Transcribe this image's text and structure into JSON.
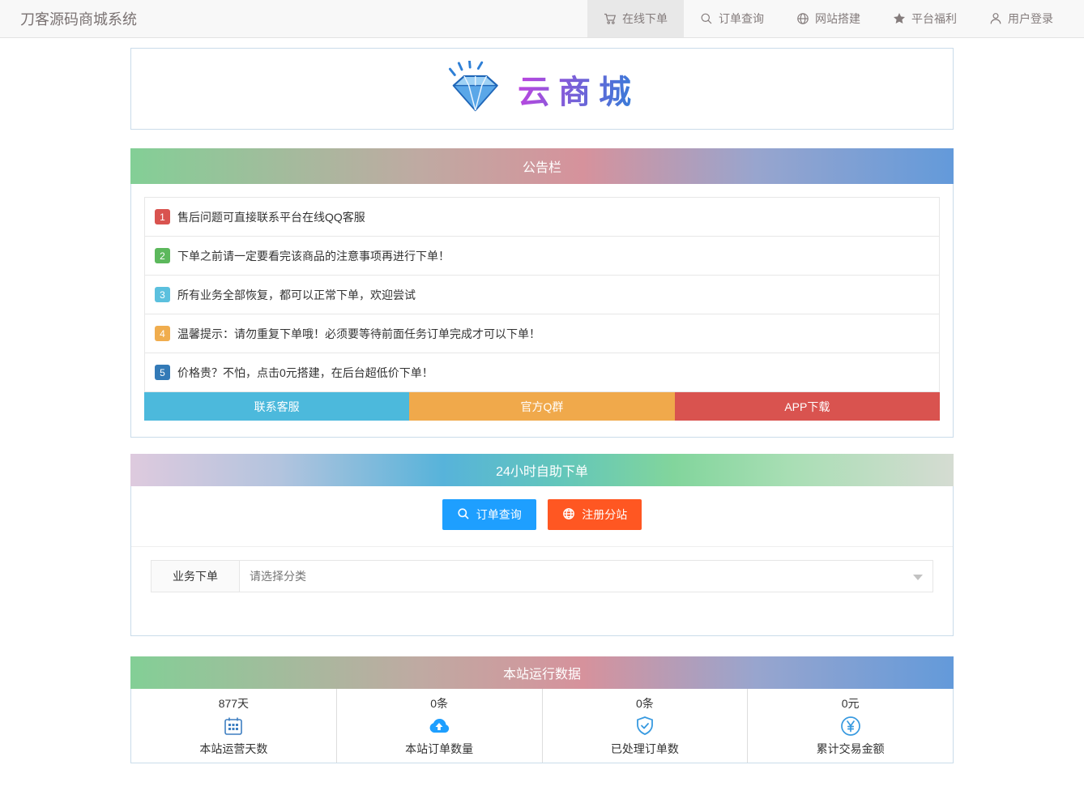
{
  "navbar": {
    "brand": "刀客源码商城系统",
    "items": [
      {
        "label": "在线下单",
        "icon": "cart-icon",
        "active": true
      },
      {
        "label": "订单查询",
        "icon": "search-icon",
        "active": false
      },
      {
        "label": "网站搭建",
        "icon": "globe-icon",
        "active": false
      },
      {
        "label": "平台福利",
        "icon": "star-icon",
        "active": false
      },
      {
        "label": "用户登录",
        "icon": "user-icon",
        "active": false
      }
    ]
  },
  "logo": {
    "text": "云商城",
    "icon": "diamond-logo-icon"
  },
  "announcement": {
    "title": "公告栏",
    "items": [
      {
        "num": "1",
        "text": "售后问题可直接联系平台在线QQ客服",
        "color": "#d9534f"
      },
      {
        "num": "2",
        "text": "下单之前请一定要看完该商品的注意事项再进行下单！",
        "color": "#5cb85c"
      },
      {
        "num": "3",
        "text": "所有业务全部恢复，都可以正常下单，欢迎尝试",
        "color": "#5bc0de"
      },
      {
        "num": "4",
        "text": "温馨提示：请勿重复下单哦！必须要等待前面任务订单完成才可以下单！",
        "color": "#f0ad4e"
      },
      {
        "num": "5",
        "text": "价格贵？不怕，点击0元搭建，在后台超低价下单！",
        "color": "#337ab7"
      }
    ],
    "buttons": [
      {
        "label": "联系客服",
        "color": "#4cb9dc"
      },
      {
        "label": "官方Q群",
        "color": "#f0a94b"
      },
      {
        "label": "APP下载",
        "color": "#d9534f"
      }
    ]
  },
  "self_order": {
    "title": "24小时自助下单",
    "buttons": [
      {
        "label": "订单查询",
        "icon": "search-icon",
        "color": "#1E9FFF"
      },
      {
        "label": "注册分站",
        "icon": "globe-icon",
        "color": "#FF5722"
      }
    ],
    "form": {
      "label": "业务下单",
      "select_placeholder": "请选择分类"
    }
  },
  "stats": {
    "title": "本站运行数据",
    "items": [
      {
        "value": "877天",
        "label": "本站运营天数",
        "icon": "calendar-icon"
      },
      {
        "value": "0条",
        "label": "本站订单数量",
        "icon": "cloud-upload-icon"
      },
      {
        "value": "0条",
        "label": "已处理订单数",
        "icon": "shield-check-icon"
      },
      {
        "value": "0元",
        "label": "累计交易金额",
        "icon": "yuan-circle-icon"
      }
    ]
  },
  "theme": {
    "header_gradient_a": [
      "#83cf96",
      "#d6929c",
      "#639ada"
    ],
    "header_gradient_b": [
      "#decade",
      "#57b3da",
      "#82d59c",
      "#d5dcd2"
    ],
    "stat_icon_blue": "#1E9FFF",
    "panel_border": "#cadcea",
    "navbar_bg": "#f8f8f8"
  }
}
